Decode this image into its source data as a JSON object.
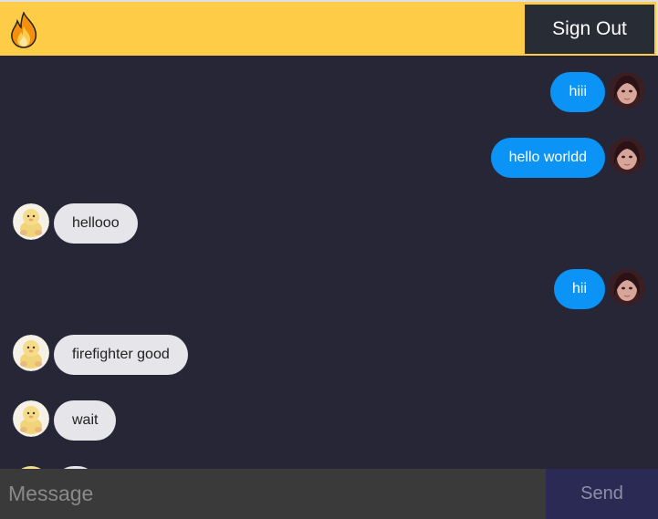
{
  "header": {
    "logo_icon": "fire-icon",
    "signout_label": "Sign Out"
  },
  "messages": [
    {
      "direction": "sent",
      "text": "hiii",
      "avatar": "avatar-dark-hair"
    },
    {
      "direction": "sent",
      "text": "hello worldd",
      "avatar": "avatar-dark-hair"
    },
    {
      "direction": "received",
      "text": "hellooo",
      "avatar": "avatar-yellow-plush"
    },
    {
      "direction": "sent",
      "text": "hii",
      "avatar": "avatar-dark-hair"
    },
    {
      "direction": "received",
      "text": "firefighter good",
      "avatar": "avatar-yellow-plush"
    },
    {
      "direction": "received",
      "text": "wait",
      "avatar": "avatar-yellow-plush"
    }
  ],
  "composer": {
    "placeholder": "Message",
    "value": "",
    "send_label": "Send"
  },
  "colors": {
    "header": "#ffcc47",
    "background": "#262636",
    "sent_bubble": "#0b93f6",
    "received_bubble": "#e5e5ea",
    "send_button": "#2a2a55"
  }
}
